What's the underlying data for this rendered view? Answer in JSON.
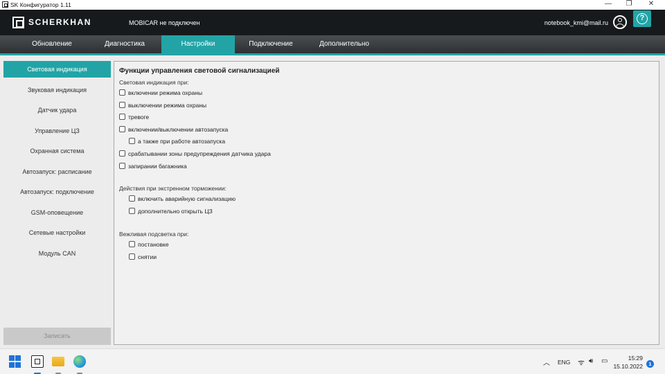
{
  "window": {
    "title": "SK Конфигуратор 1.11",
    "minimize_glyph": "—",
    "restore_glyph": "❐",
    "close_glyph": "✕"
  },
  "header": {
    "logo_text": "SCHERKHAN",
    "connection_status": "MOBICAR не подключен",
    "user_email": "notebook_kmi@mail.ru",
    "help_glyph": "?"
  },
  "tabs": [
    {
      "label": "Обновление"
    },
    {
      "label": "Диагностика"
    },
    {
      "label": "Настройки"
    },
    {
      "label": "Подключение"
    },
    {
      "label": "Дополнительно"
    }
  ],
  "active_tab": "Настройки",
  "sidebar": {
    "items": [
      {
        "label": "Световая индикация"
      },
      {
        "label": "Звуковая индикация"
      },
      {
        "label": "Датчик удара"
      },
      {
        "label": "Управление ЦЗ"
      },
      {
        "label": "Охранная система"
      },
      {
        "label": "Автозапуск: расписание"
      },
      {
        "label": "Автозапуск: подключение"
      },
      {
        "label": "GSM-оповещение"
      },
      {
        "label": "Сетевые настройки"
      },
      {
        "label": "Модуль CAN"
      }
    ],
    "active_item": "Световая индикация",
    "save_label": "Записать"
  },
  "main": {
    "title": "Функции управления световой сигнализацией",
    "group1": {
      "label": "Световая индикация при:",
      "options": [
        {
          "label": "включении режима охраны",
          "checked": false
        },
        {
          "label": "выключении режима охраны",
          "checked": false
        },
        {
          "label": "тревоге",
          "checked": false
        },
        {
          "label": "включении/выключении автозапуска",
          "checked": false
        },
        {
          "label": "а также при работе автозапуска",
          "checked": false
        },
        {
          "label": "срабатывании зоны предупреждения датчика удара",
          "checked": false
        },
        {
          "label": "запирании багажника",
          "checked": false
        }
      ]
    },
    "group2": {
      "label": "Действия при экстренном торможении:",
      "options": [
        {
          "label": "включить аварийную сигнализацию",
          "checked": false
        },
        {
          "label": "дополнительно открыть ЦЗ",
          "checked": false
        }
      ]
    },
    "group3": {
      "label": "Вежливая подсветка при:",
      "options": [
        {
          "label": "постановке",
          "checked": false
        },
        {
          "label": "снятии",
          "checked": false
        }
      ]
    }
  },
  "taskbar": {
    "icons": [
      "windows-start-icon",
      "sk-configurator-icon",
      "file-explorer-icon",
      "browser-icon"
    ],
    "tray": {
      "chevron_glyph": "︿",
      "language": "ENG",
      "wifi_glyph": "ᯤ",
      "volume_glyph": "🔊︎",
      "time": "15:29",
      "date": "15.10.2022",
      "notifications": "1"
    }
  }
}
